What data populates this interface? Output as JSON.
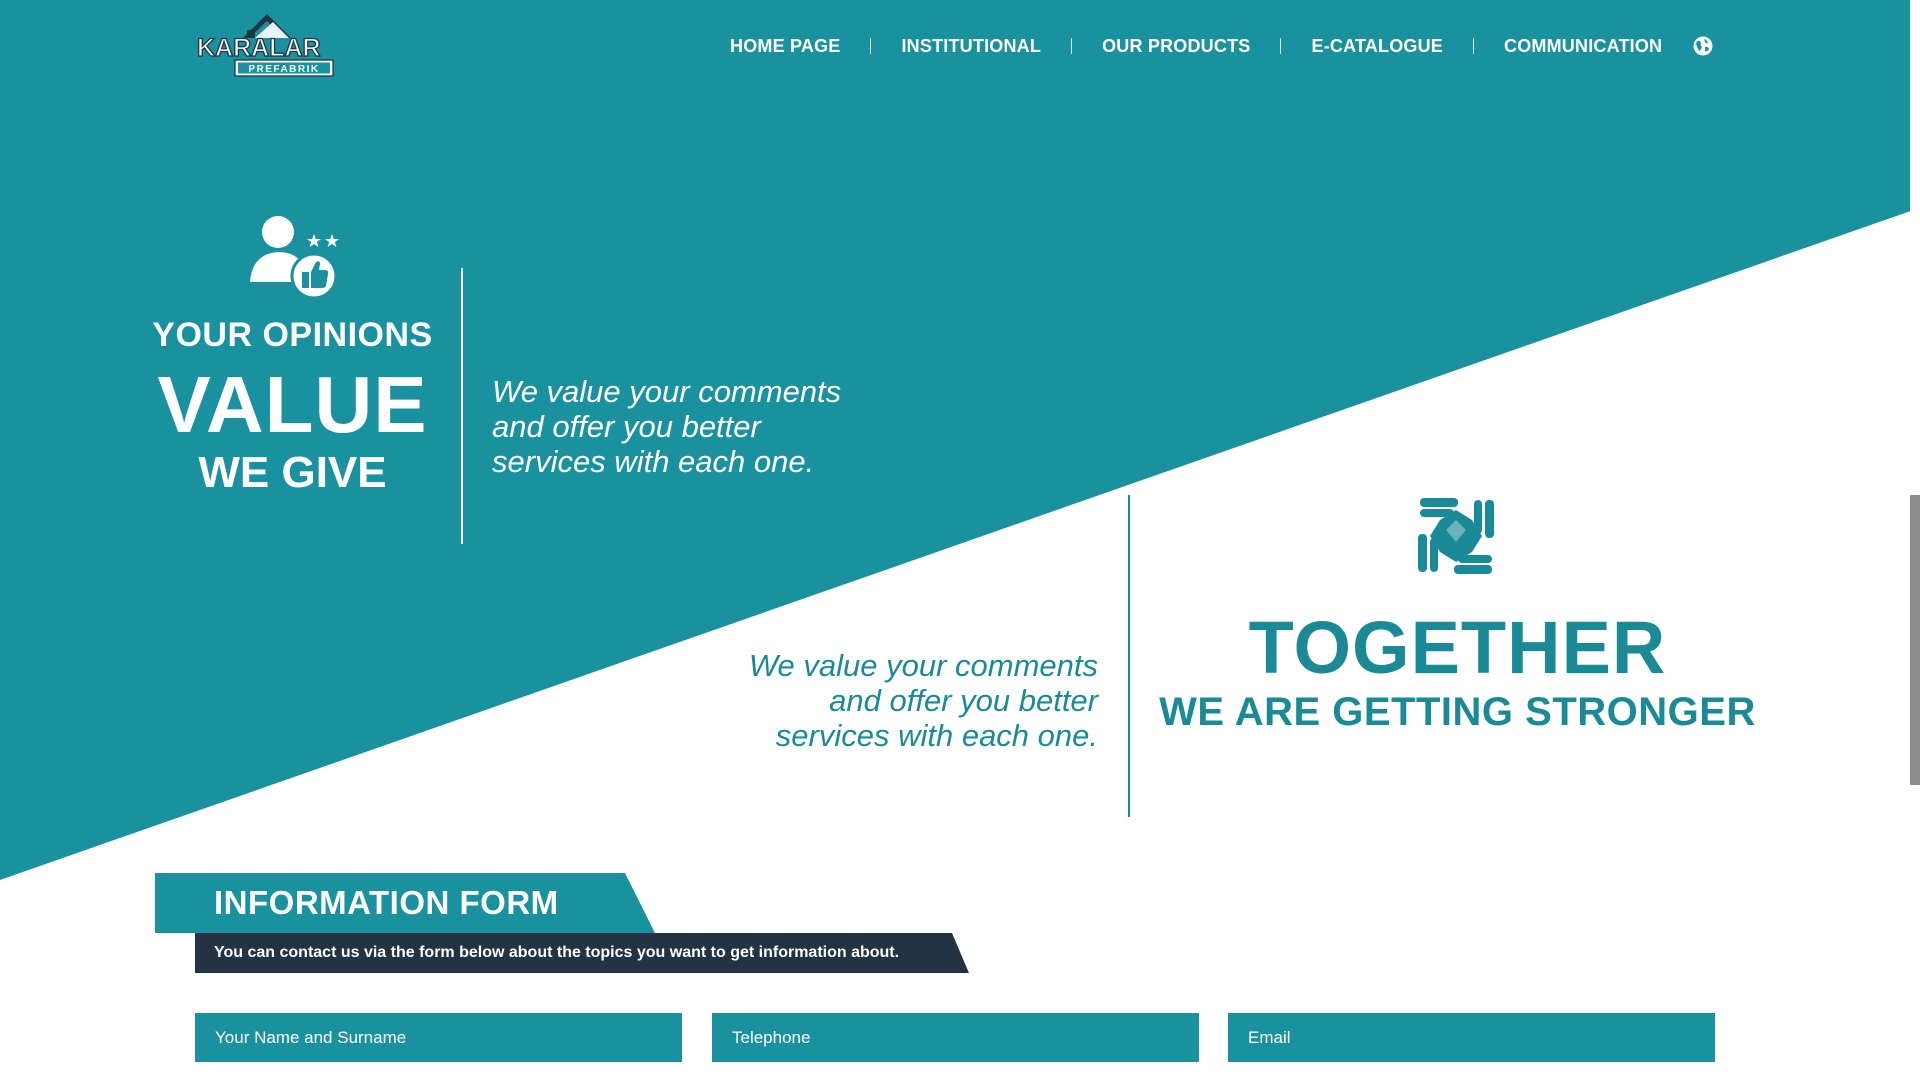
{
  "brand": {
    "logo_name": "KARALAR",
    "logo_sub": "PREFABRIK",
    "colors": {
      "teal": "#1a919f",
      "teal_text": "#1a8a97",
      "dark_navy": "#223443",
      "white": "#ffffff"
    }
  },
  "nav": {
    "items": [
      {
        "label": "HOME PAGE"
      },
      {
        "label": "INSTITUTIONAL"
      },
      {
        "label": "OUR PRODUCTS"
      },
      {
        "label": "E-CATALOGUE"
      },
      {
        "label": "COMMUNICATION"
      }
    ],
    "language_icon": "globe-icon"
  },
  "opinions": {
    "icon": "user-thumbs-up-icon",
    "line1": "YOUR OPINIONS",
    "line2": "VALUE",
    "line3": "WE GIVE",
    "text_lines": [
      "We value your comments",
      "and offer you better",
      "services with each one."
    ]
  },
  "together": {
    "icon": "joined-hands-icon",
    "title": "TOGETHER",
    "subtitle": "WE ARE GETTING STRONGER",
    "text_lines": [
      "We value your comments",
      "and offer you better",
      "services with each one."
    ]
  },
  "form": {
    "title": "INFORMATION FORM",
    "subtitle": "You can contact us via the form below about the topics you want to get information about.",
    "fields": {
      "name_placeholder": "Your Name and Surname",
      "phone_placeholder": "Telephone",
      "email_placeholder": "Email"
    }
  }
}
